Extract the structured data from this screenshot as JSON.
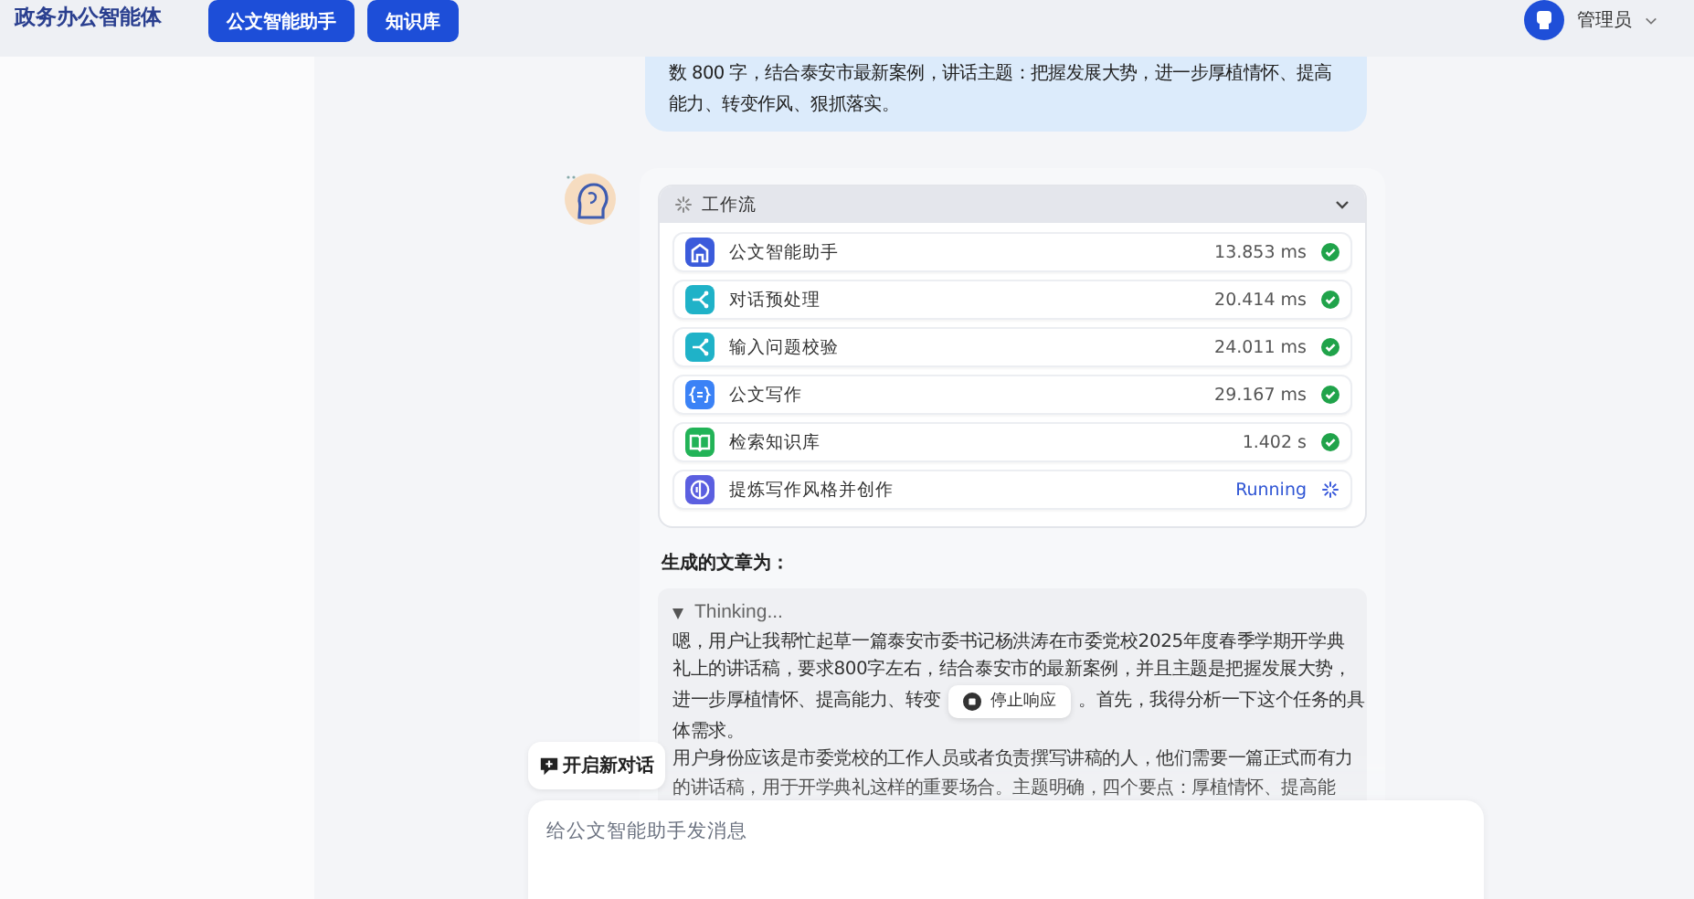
{
  "header": {
    "logo": "政务办公智能体",
    "nav": [
      {
        "label": "公文智能助手",
        "selected": true
      },
      {
        "label": "知识库",
        "selected": true
      }
    ],
    "user": {
      "name": "管理员"
    }
  },
  "chat": {
    "user_message": {
      "lines": [
        "数 800 字，结合泰安市最新案例，讲话主题：把握发展大势，进一步厚植情怀、提高",
        "能力、转变作风、狠抓落实。"
      ]
    },
    "assistant": {
      "workflow": {
        "title": "工作流",
        "expanded": true,
        "steps": [
          {
            "kind": "home",
            "color": "#3b5bdb",
            "label": "公文智能助手",
            "time": "13.853 ms",
            "done": true
          },
          {
            "kind": "branch",
            "color": "#1fb2c8",
            "label": "对话预处理",
            "time": "20.414 ms",
            "done": true
          },
          {
            "kind": "branch",
            "color": "#1fb2c8",
            "label": "输入问题校验",
            "time": "24.011 ms",
            "done": true
          },
          {
            "kind": "code",
            "color": "#3b82f6",
            "label": "公文写作",
            "time": "29.167 ms",
            "done": true
          },
          {
            "kind": "book",
            "color": "#22b357",
            "label": "检索知识库",
            "time": "1.402 s",
            "done": true
          },
          {
            "kind": "brain",
            "color": "#5b5fe0",
            "label": "提炼写作风格并创作",
            "time": "Running",
            "done": false
          }
        ]
      },
      "heading": "生成的文章为：",
      "thinking": {
        "label": "Thinking...",
        "expanded": true,
        "stop_button": "停止响应",
        "lines": [
          {
            "text": "嗯，用户让我帮忙起草一篇泰安市委书记杨洪涛在市委党校2025年度春季学期开学典"
          },
          {
            "text": "礼上的讲话稿，要求800字左右，结合泰安市的最新案例，并且主题是把握发展大势，"
          },
          {
            "text": "进一步厚植情怀、提高能力、转变",
            "text_after": "。首先，我得分析一下这个任务的具"
          },
          {
            "text": "体需求。"
          },
          {
            "text": "用户身份应该是市委党校的工作人员或者负责撰写讲稿的人，他们需要一篇正式而有力"
          },
          {
            "text": "的讲话稿，用于开学典礼这样的重要场合。主题明确，四个要点：厚植情怀、提高能"
          }
        ]
      }
    }
  },
  "composer": {
    "new_chat_button": "开启新对话",
    "input": {
      "placeholder": "给公文智能助手发消息"
    }
  }
}
